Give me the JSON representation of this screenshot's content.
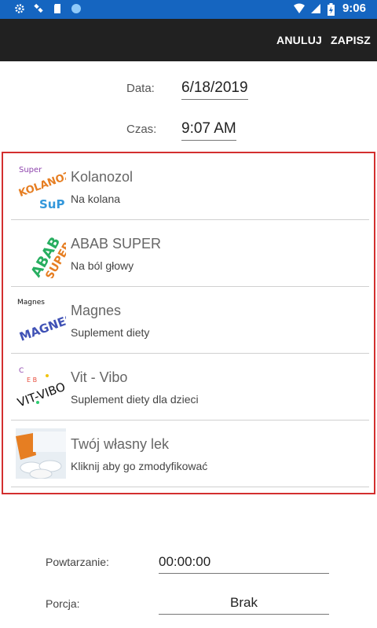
{
  "status_bar": {
    "icons_left": [
      "gear-icon",
      "satellite-icon",
      "sd-card-icon",
      "circle-icon"
    ],
    "icons_right": [
      "wifi-icon",
      "signal-icon",
      "battery-charging-icon"
    ],
    "time": "9:06"
  },
  "toolbar": {
    "cancel_label": "ANULUJ",
    "save_label": "ZAPISZ"
  },
  "date": {
    "label": "Data:",
    "value": "6/18/2019"
  },
  "time": {
    "label": "Czas:",
    "value": "9:07 AM"
  },
  "medicines": [
    {
      "name": "Kolanozol",
      "description": "Na kolana",
      "thumb_text": "Super KOLANOZOL"
    },
    {
      "name": "ABAB SUPER",
      "description": "Na ból głowy",
      "thumb_text": "ABAB SUPER"
    },
    {
      "name": "Magnes",
      "description": "Suplement diety",
      "thumb_text": "Magnes"
    },
    {
      "name": "Vit - Vibo",
      "description": "Suplement diety dla dzieci",
      "thumb_text": "VIT-VIBO"
    },
    {
      "name": "Twój własny lek",
      "description": "Kliknij aby go zmodyfikować",
      "thumb_text": ""
    }
  ],
  "repeat": {
    "label": "Powtarzanie:",
    "value": "00:00:00"
  },
  "portion": {
    "label": "Porcja:",
    "value": "Brak"
  },
  "colors": {
    "status_bar": "#1565c0",
    "toolbar": "#212121",
    "list_border": "#d32f2f"
  }
}
